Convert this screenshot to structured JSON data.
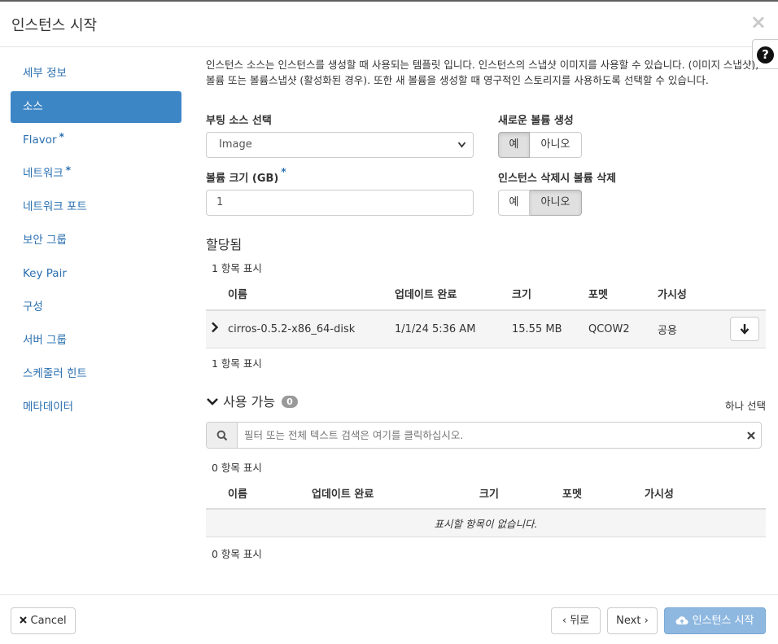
{
  "header": {
    "title": "인스턴스 시작",
    "close": "×",
    "help": "?"
  },
  "sidebar": {
    "items": [
      {
        "label": "세부 정보",
        "required": ""
      },
      {
        "label": "소스",
        "required": ""
      },
      {
        "label": "Flavor",
        "required": "*"
      },
      {
        "label": "네트워크",
        "required": "*"
      },
      {
        "label": "네트워크 포트",
        "required": ""
      },
      {
        "label": "보안 그룹",
        "required": ""
      },
      {
        "label": "Key Pair",
        "required": ""
      },
      {
        "label": "구성",
        "required": ""
      },
      {
        "label": "서버 그룹",
        "required": ""
      },
      {
        "label": "스케줄러 힌트",
        "required": ""
      },
      {
        "label": "메타데이터",
        "required": ""
      }
    ]
  },
  "source": {
    "description": "인스턴스 소스는 인스턴스를 생성할 때 사용되는 템플릿 입니다. 인스턴스의 스냅샷 이미지를 사용할 수 있습니다. (이미지 스냅샷), 볼륨 또는 볼륨스냅샷 (활성화된 경우). 또한 새 볼륨을 생성할 때 영구적인 스토리지를 사용하도록 선택할 수 있습니다.",
    "boot_source_label": "부팅 소스 선택",
    "boot_source_value": "Image",
    "new_volume_label": "새로운 볼륨 생성",
    "yes": "예",
    "no": "아니오",
    "volume_size_label": "볼륨 크기 (GB)",
    "volume_size_required": "*",
    "volume_size_value": "1",
    "delete_volume_label": "인스턴스 삭제시 볼륨 삭제"
  },
  "allocated": {
    "title": "할당됨",
    "count_top": "1 항목 표시",
    "count_bottom": "1 항목 표시",
    "columns": [
      "이름",
      "업데이트 완료",
      "크기",
      "포멧",
      "가시성"
    ],
    "rows": [
      {
        "name": "cirros-0.5.2-x86_64-disk",
        "updated": "1/1/24 5:36 AM",
        "size": "15.55 MB",
        "format": "QCOW2",
        "visibility": "공용"
      }
    ]
  },
  "available": {
    "title": "사용 가능",
    "badge": "0",
    "select_one": "하나 선택",
    "filter_placeholder": "필터 또는 전체 텍스트 검색은 여기를 클릭하십시오.",
    "count_top": "0 항목 표시",
    "count_bottom": "0 항목 표시",
    "columns": [
      "이름",
      "업데이트 완료",
      "크기",
      "포멧",
      "가시성"
    ],
    "empty": "표시할 항목이 없습니다."
  },
  "footer": {
    "cancel": "Cancel",
    "back": "뒤로",
    "next": "Next",
    "launch": "인스턴스 시작"
  },
  "colors": {
    "accent": "#3d86c6",
    "link": "#2a6fb0",
    "primary_disabled": "#8fb8e0"
  }
}
